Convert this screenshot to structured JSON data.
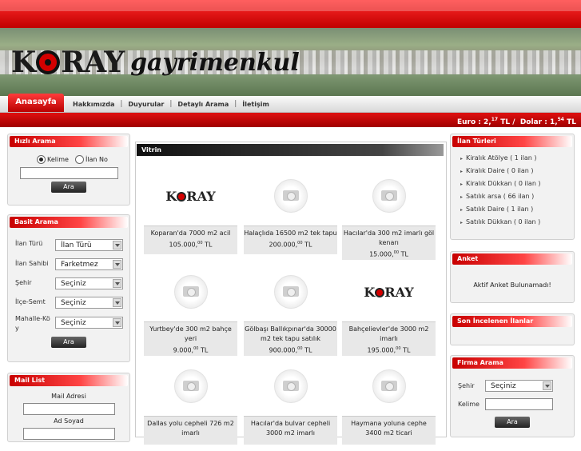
{
  "brand": {
    "logo_left": "K",
    "logo_right": "RAY",
    "logo_word": "gayrimenkul"
  },
  "nav": {
    "active": "Anasayfa",
    "items": [
      "Hakkımızda",
      "Duyurular",
      "Detaylı Arama",
      "İletişim"
    ],
    "separator": "|"
  },
  "currency": {
    "euro_label": "Euro :",
    "euro_int": "2,",
    "euro_dec": "17",
    "euro_unit": "TL /",
    "dolar_label": "Dolar :",
    "dolar_int": "1,",
    "dolar_dec": "54",
    "dolar_unit": "TL"
  },
  "quick_search": {
    "title": "Hızlı Arama",
    "option_keyword": "Kelime",
    "option_listing": "İlan No",
    "button": "Ara"
  },
  "basic_search": {
    "title": "Basit Arama",
    "fields": [
      {
        "label": "İlan Türü",
        "value": "İlan Türü"
      },
      {
        "label": "İlan Sahibi",
        "value": "Farketmez"
      },
      {
        "label": "Şehir",
        "value": "Seçiniz"
      },
      {
        "label": "İlçe-Semt",
        "value": "Seçiniz"
      },
      {
        "label": "Mahalle-Kö y",
        "value": "Seçiniz"
      }
    ],
    "button": "Ara"
  },
  "mail_list": {
    "title": "Mail List",
    "mail_label": "Mail Adresi",
    "name_label": "Ad Soyad"
  },
  "vitrin": {
    "title": "Vitrin",
    "cards": [
      {
        "image": "koray-logo",
        "text": "Koparan'da 7000 m2 acil",
        "price": "105.000,",
        "dec": "00",
        "unit": "TL"
      },
      {
        "image": "camera-placeholder",
        "text": "Halaçlıda 16500 m2 tek tapu",
        "price": "200.000,",
        "dec": "00",
        "unit": "TL"
      },
      {
        "image": "camera-placeholder",
        "text": "Hacılar'da 300 m2 imarlı göl kenarı",
        "price": "15.000,",
        "dec": "00",
        "unit": "TL"
      },
      {
        "image": "camera-placeholder",
        "text": "Yurtbey'de 300 m2 bahçe yeri",
        "price": "9.000,",
        "dec": "00",
        "unit": "TL"
      },
      {
        "image": "camera-placeholder",
        "text": "Gölbaşı Ballıkpınar'da 30000 m2 tek tapu satılık",
        "price": "900.000,",
        "dec": "00",
        "unit": "TL"
      },
      {
        "image": "koray-logo",
        "text": "Bahçelievler'de 3000 m2 imarlı",
        "price": "195.000,",
        "dec": "00",
        "unit": "TL"
      },
      {
        "image": "camera-placeholder",
        "text": "Dallas yolu cepheli 726 m2 imarlı",
        "price": "",
        "dec": "",
        "unit": ""
      },
      {
        "image": "camera-placeholder",
        "text": "Hacılar'da bulvar cepheli 3000 m2 imarlı",
        "price": "",
        "dec": "",
        "unit": ""
      },
      {
        "image": "camera-placeholder",
        "text": "Haymana yoluna cephe 3400 m2 ticari",
        "price": "",
        "dec": "",
        "unit": ""
      }
    ]
  },
  "listing_types": {
    "title": "İlan Türleri",
    "items": [
      "Kiralık Atölye ( 1 ilan )",
      "Kiralık Daire ( 0 ilan )",
      "Kiralık Dükkan ( 0 ilan )",
      "Satılık arsa ( 66 ilan )",
      "Satılık Daire ( 1 ilan )",
      "Satılık Dükkan ( 0 ilan )"
    ]
  },
  "poll": {
    "title": "Anket",
    "text": "Aktif Anket Bulunamadı!"
  },
  "recent": {
    "title": "Son İncelenen İlanlar"
  },
  "firm_search": {
    "title": "Firma Arama",
    "city_label": "Şehir",
    "city_value": "Seçiniz",
    "keyword_label": "Kelime",
    "button": "Ara"
  }
}
